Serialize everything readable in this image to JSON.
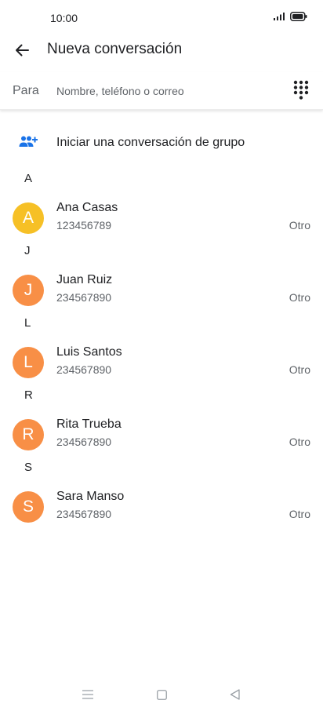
{
  "status_bar": {
    "time": "10:00",
    "icons": [
      "signal-icon",
      "battery-icon"
    ]
  },
  "header": {
    "title": "Nueva conversación",
    "back_icon": "back-arrow-icon"
  },
  "to_field": {
    "label": "Para",
    "placeholder": "Nombre, teléfono o correo",
    "value": "",
    "dialpad_icon": "dialpad-icon"
  },
  "group": {
    "label": "Iniciar una conversación de grupo",
    "icon": "group-add-icon"
  },
  "colors": {
    "accent": "#1a73e8",
    "avatar_yellow": "#f6c026",
    "avatar_orange": "#f88f46",
    "text_primary": "#202124",
    "text_secondary": "#5f6368"
  },
  "contacts": [
    {
      "section": "A",
      "initial": "A",
      "name": "Ana Casas",
      "number": "123456789",
      "type": "Otro",
      "avatar_color": "#f6c026"
    },
    {
      "section": "J",
      "initial": "J",
      "name": "Juan Ruiz",
      "number": "234567890",
      "type": "Otro",
      "avatar_color": "#f88f46"
    },
    {
      "section": "L",
      "initial": "L",
      "name": "Luis Santos",
      "number": "234567890",
      "type": "Otro",
      "avatar_color": "#f88f46"
    },
    {
      "section": "R",
      "initial": "R",
      "name": "Rita Trueba",
      "number": "234567890",
      "type": "Otro",
      "avatar_color": "#f88f46"
    },
    {
      "section": "S",
      "initial": "S",
      "name": "Sara Manso",
      "number": "234567890",
      "type": "Otro",
      "avatar_color": "#f88f46"
    }
  ],
  "nav_bar": {
    "icons": [
      "menu-icon",
      "home-icon",
      "back-icon"
    ]
  }
}
